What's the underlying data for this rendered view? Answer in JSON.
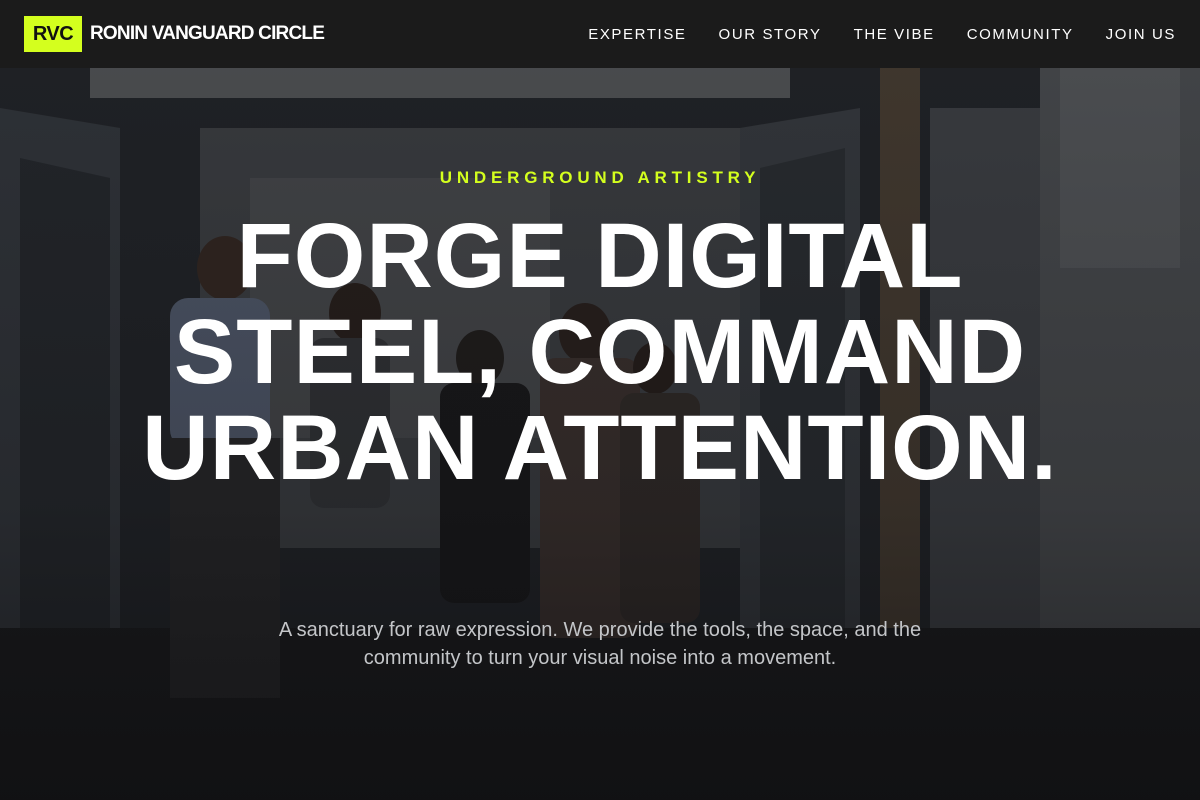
{
  "header": {
    "logo_text": "RVC",
    "brand_name": "RONIN VANGUARD CIRCLE",
    "nav": [
      {
        "label": "EXPERTISE"
      },
      {
        "label": "OUR STORY"
      },
      {
        "label": "THE VIBE"
      },
      {
        "label": "COMMUNITY"
      },
      {
        "label": "JOIN US"
      }
    ]
  },
  "hero": {
    "eyebrow": "UNDERGROUND ARTISTRY",
    "headline": "FORGE DIGITAL STEEL, COMMAND URBAN ATTENTION.",
    "subhead": "A sanctuary for raw expression. We provide the tools, the space, and the community to turn your visual noise into a movement.",
    "background_image": "gallery-crowd-photo"
  },
  "colors": {
    "accent": "#d4ff1e",
    "header_bg": "#1b1b1b",
    "text": "#ffffff",
    "muted_text": "#c3c5c8"
  }
}
